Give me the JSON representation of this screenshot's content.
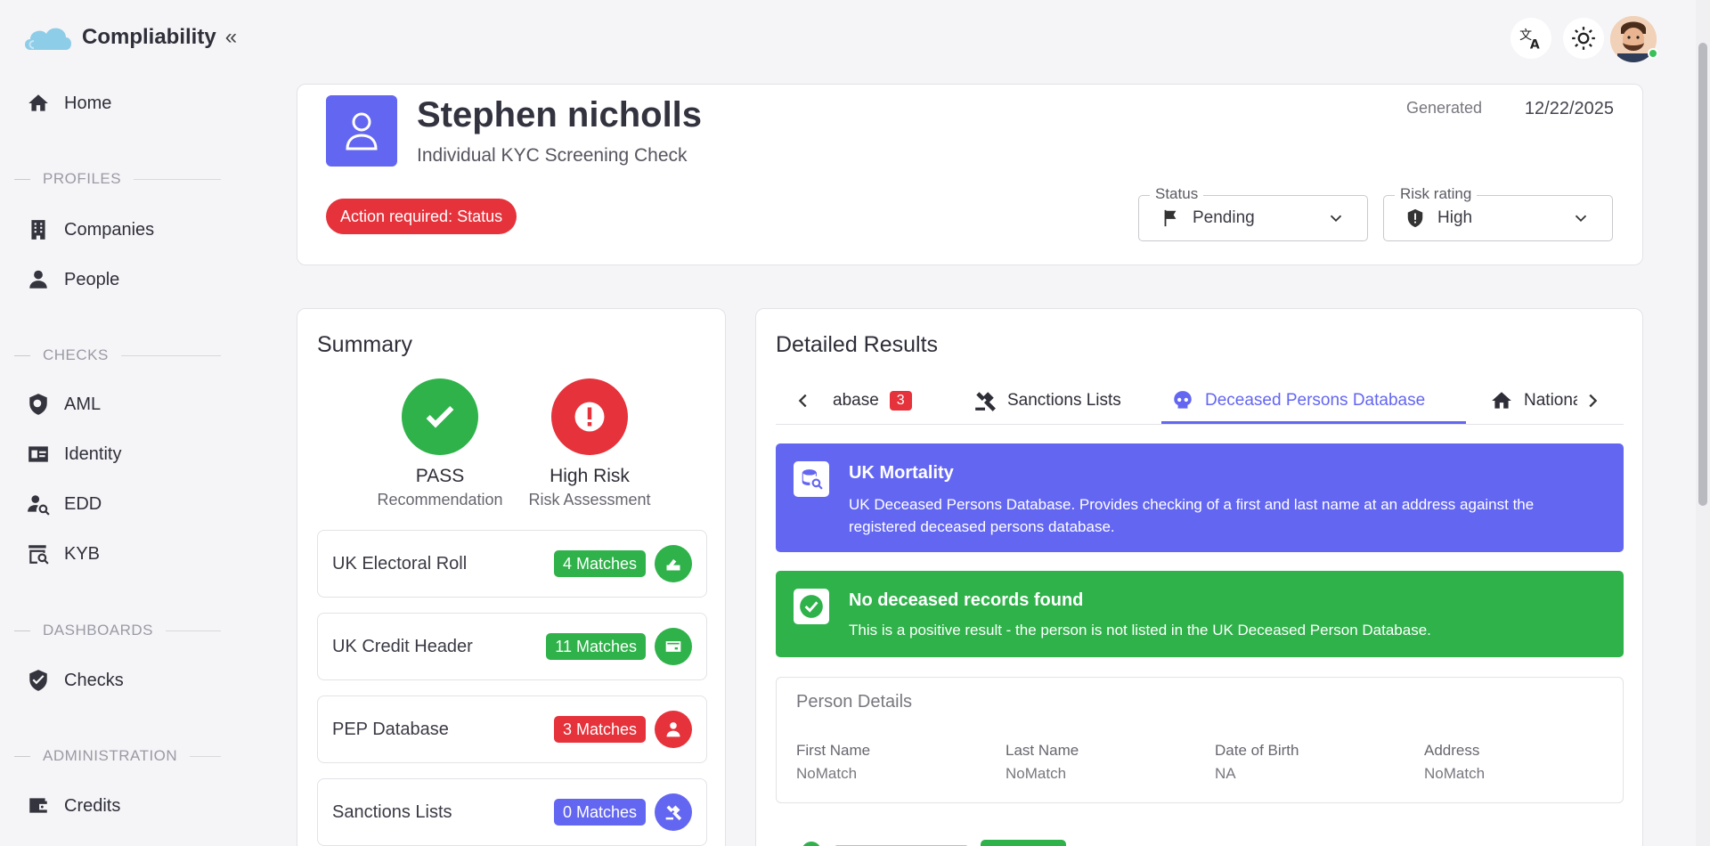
{
  "app": {
    "name": "Compliability"
  },
  "sidebar": {
    "items": [
      {
        "label": "Home"
      },
      {
        "label": "Companies"
      },
      {
        "label": "People"
      },
      {
        "label": "AML"
      },
      {
        "label": "Identity"
      },
      {
        "label": "EDD"
      },
      {
        "label": "KYB"
      },
      {
        "label": "Checks"
      },
      {
        "label": "Credits"
      }
    ],
    "sections": [
      "PROFILES",
      "CHECKS",
      "DASHBOARDS",
      "ADMINISTRATION"
    ]
  },
  "header": {
    "name": "Stephen nicholls",
    "subtitle": "Individual KYC Screening Check",
    "generated_label": "Generated",
    "generated_date": "12/22/2025",
    "action_required": "Action required: Status",
    "status_label": "Status",
    "status_value": "Pending",
    "risk_label": "Risk rating",
    "risk_value": "High"
  },
  "summary": {
    "title": "Summary",
    "recommendation": {
      "value": "PASS",
      "label": "Recommendation",
      "color": "#2fb24a"
    },
    "risk": {
      "value": "High Risk",
      "label": "Risk Assessment",
      "color": "#e5323b"
    },
    "sources": [
      {
        "name": "UK Electoral Roll",
        "matches": "4 Matches",
        "color": "#2fb24a",
        "icon": "ballot-box-icon"
      },
      {
        "name": "UK Credit Header",
        "matches": "11 Matches",
        "color": "#2fb24a",
        "icon": "credit-card-icon"
      },
      {
        "name": "PEP Database",
        "matches": "3 Matches",
        "color": "#e5323b",
        "icon": "person-icon"
      },
      {
        "name": "Sanctions Lists",
        "matches": "0 Matches",
        "color": "#6366f1",
        "icon": "gavel-icon"
      }
    ]
  },
  "details": {
    "title": "Detailed Results",
    "tabs": [
      {
        "label": "abase",
        "count": "3"
      },
      {
        "label": "Sanctions Lists"
      },
      {
        "label": "Deceased Persons Database",
        "active": true
      },
      {
        "label": "Nationa"
      }
    ],
    "source_banner": {
      "title": "UK Mortality",
      "text": "UK Deceased Persons Database. Provides checking of a first and last name at an address against the registered deceased persons database.",
      "color": "#6366f1"
    },
    "result_banner": {
      "title": "No deceased records found",
      "text": "This is a positive result - the person is not listed in the UK Deceased Person Database.",
      "color": "#2fb24a"
    },
    "person_details": {
      "title": "Person Details",
      "fields": [
        {
          "key": "First Name",
          "value": "NoMatch"
        },
        {
          "key": "Last Name",
          "value": "NoMatch"
        },
        {
          "key": "Date of Birth",
          "value": "NA"
        },
        {
          "key": "Address",
          "value": "NoMatch"
        }
      ]
    }
  }
}
